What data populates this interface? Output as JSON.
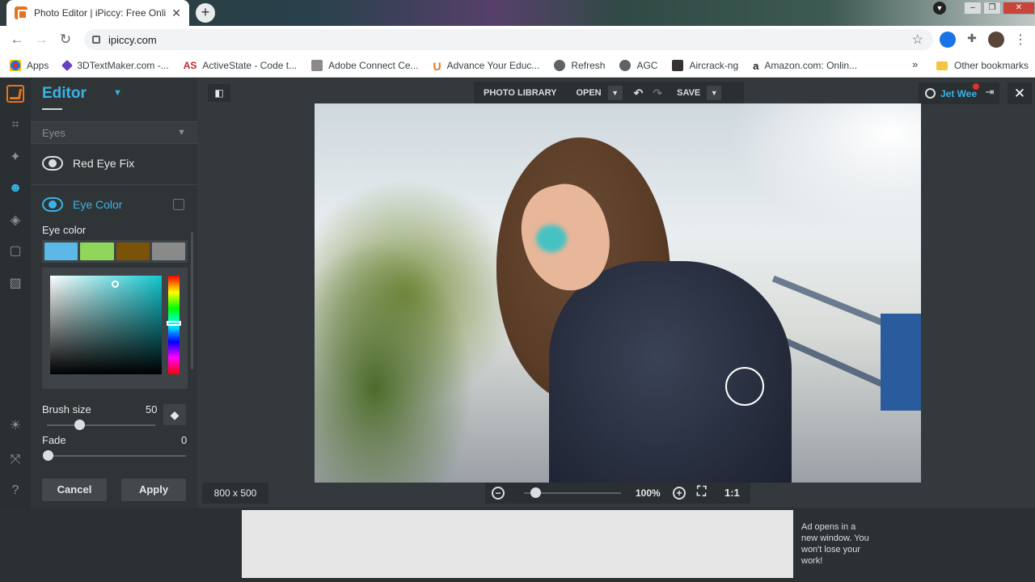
{
  "browser": {
    "tab_title": "Photo Editor | iPiccy: Free Online",
    "tab_close": "✕",
    "new_tab": "+",
    "url": "ipiccy.com",
    "bookmarks": [
      {
        "label": "Apps",
        "icon": "apps-grid-icon",
        "color": "#d93025"
      },
      {
        "label": "3DTextMaker.com -...",
        "icon": "3dtextmaker-icon",
        "color": "#6a3fc4"
      },
      {
        "label": "ActiveState - Code t...",
        "icon": "activestate-icon",
        "color": "#c62828"
      },
      {
        "label": "Adobe Connect Ce...",
        "icon": "adobe-connect-icon",
        "color": "#7a7a7a"
      },
      {
        "label": "Advance Your Educ...",
        "icon": "u-logo-icon",
        "color": "#e8731a"
      },
      {
        "label": "Refresh",
        "icon": "globe-icon",
        "color": "#5f6368"
      },
      {
        "label": "AGC",
        "icon": "globe-icon",
        "color": "#5f6368"
      },
      {
        "label": "Aircrack-ng",
        "icon": "aircrack-icon",
        "color": "#333333"
      },
      {
        "label": "Amazon.com: Onlin...",
        "icon": "amazon-icon",
        "color": "#222222"
      }
    ],
    "bookmarks_more": "»",
    "other_bookmarks": "Other bookmarks"
  },
  "editor": {
    "title": "Editor",
    "section": "Eyes",
    "tools": [
      {
        "label": "Red Eye Fix"
      },
      {
        "label": "Eye Color"
      }
    ],
    "eye_color_label": "Eye color",
    "swatches": [
      "#5bb8e8",
      "#8fd65a",
      "#7a5208",
      "#8a8a8a"
    ],
    "picker_color": "#12c6cf",
    "brush_size_label": "Brush size",
    "brush_size_value": "50",
    "brush_size": 50,
    "fade_label": "Fade",
    "fade_value": "0",
    "cancel_label": "Cancel",
    "apply_label": "Apply"
  },
  "topbar": {
    "photo_library": "PHOTO LIBRARY",
    "open": "OPEN",
    "save": "SAVE"
  },
  "user": {
    "name": "Jet Wee"
  },
  "canvas": {
    "dimensions": "800 x 500",
    "zoom": "100%",
    "actual_size": "1:1"
  },
  "ad": {
    "note": "Ad opens in a new window. You won't lose your work!"
  },
  "colors": {
    "accent": "#39b3e6",
    "panel": "#2f3537",
    "rail": "#2a2f31"
  }
}
